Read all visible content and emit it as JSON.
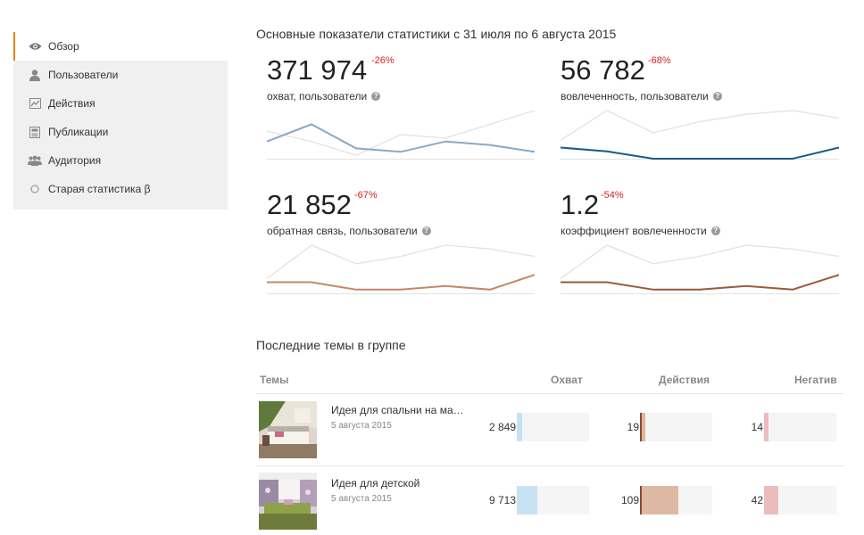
{
  "sidebar": {
    "items": [
      {
        "label": "Обзор",
        "icon": "eye-icon",
        "active": true
      },
      {
        "label": "Пользователи",
        "icon": "user-icon"
      },
      {
        "label": "Действия",
        "icon": "line-chart-icon"
      },
      {
        "label": "Публикации",
        "icon": "publication-icon"
      },
      {
        "label": "Аудитория",
        "icon": "group-icon"
      },
      {
        "label": "Старая статистика β",
        "icon": "circle-icon"
      }
    ]
  },
  "stats": {
    "title": "Основные показатели статистики с 31 июля по 6 августа 2015",
    "cards": [
      {
        "value": "371 974",
        "delta": "-26%",
        "label": "охват, пользователи",
        "help": "?",
        "current": [
          5,
          10,
          3,
          2,
          5,
          4,
          2
        ],
        "previous": [
          8,
          5,
          1,
          7,
          6,
          10,
          14
        ],
        "color": "#86a9c7"
      },
      {
        "value": "56 782",
        "delta": "-68%",
        "label": "вовлеченность, пользователи",
        "help": "?",
        "current": [
          3,
          2,
          0,
          0,
          0,
          0,
          3
        ],
        "previous": [
          5,
          13,
          7,
          10,
          12,
          13,
          11
        ],
        "color": "#1a5a8a"
      },
      {
        "value": "21 852",
        "delta": "-67%",
        "label": "обратная связь, пользователи",
        "help": "?",
        "current": [
          3,
          3,
          1,
          1,
          2,
          1,
          5
        ],
        "previous": [
          4,
          13,
          8,
          10,
          13,
          12,
          10
        ],
        "color": "#c08a68"
      },
      {
        "value": "1.2",
        "delta": "-54%",
        "label": "коэффициент вовлеченности",
        "help": "?",
        "current": [
          3,
          3,
          1,
          1,
          2,
          1,
          5
        ],
        "previous": [
          4,
          13,
          8,
          10,
          13,
          12,
          10
        ],
        "color": "#9a5a3a"
      }
    ]
  },
  "topics": {
    "title": "Последние темы в группе",
    "headers": {
      "topics": "Темы",
      "reach": "Охват",
      "actions": "Действия",
      "negative": "Негатив"
    },
    "rows": [
      {
        "title": "Идея для спальни на ма…",
        "date": "5 августа 2015",
        "reach": "2 849",
        "reach_frac": 0.07,
        "actions": "19",
        "actions_frac": 0.08,
        "negative": "14",
        "negative_frac": 0.06
      },
      {
        "title": "Идея для детской",
        "date": "5 августа 2015",
        "reach": "9 713",
        "reach_frac": 0.28,
        "actions": "109",
        "actions_frac": 0.53,
        "negative": "42",
        "negative_frac": 0.2
      }
    ],
    "colors": {
      "reach": "#c6e2f2",
      "actions": "#ddb9a4",
      "actions_marker": "#8a4a30",
      "negative": "#ecbcbc"
    }
  }
}
